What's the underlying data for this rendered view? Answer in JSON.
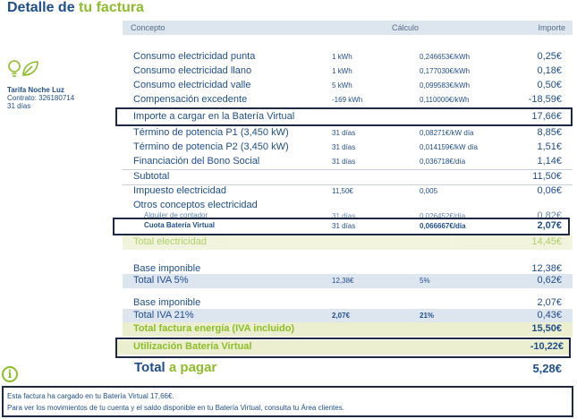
{
  "header": {
    "title_part1": "Detalle de",
    "title_part2": "tu factura",
    "col_concepto": "Concepto",
    "col_calculo": "Cálculo",
    "col_importe": "Importe"
  },
  "contract": {
    "plan": "Tarifa Noche Luz",
    "number": "Contrato: 326180714",
    "days": "31 días"
  },
  "rows": [
    {
      "concepto": "Consumo electricidad punta",
      "cantidad": "1 kWh",
      "precio": "0,246653€/kWh",
      "importe": "0,25€"
    },
    {
      "concepto": "Consumo electricidad llano",
      "cantidad": "1 kWh",
      "precio": "0,177030€/kWh",
      "importe": "0,18€"
    },
    {
      "concepto": "Consumo electricidad valle",
      "cantidad": "5 kWh",
      "precio": "0,099583€/kWh",
      "importe": "0,50€"
    },
    {
      "concepto": "Compensación excedente",
      "cantidad": "-169 kWh",
      "precio": "0,110000€/kWh",
      "importe": "-18,59€"
    },
    {
      "concepto": "Importe a cargar en la Batería Virtual",
      "cantidad": "",
      "precio": "",
      "importe": "17,66€"
    },
    {
      "concepto": "Término de potencia P1 (3,450 kW)",
      "cantidad": "31 días",
      "precio": "0,08271€/kW día",
      "importe": "8,85€"
    },
    {
      "concepto": "Término de potencia P2 (3,450 kW)",
      "cantidad": "31 días",
      "precio": "0,014159€/kW día",
      "importe": "1,51€"
    },
    {
      "concepto": "Financiación del Bono Social",
      "cantidad": "31 días",
      "precio": "0,036718€/día",
      "importe": "1,14€"
    },
    {
      "concepto": "Subtotal",
      "cantidad": "",
      "precio": "",
      "importe": "11,50€"
    },
    {
      "concepto": "Impuesto electricidad",
      "cantidad": "11,50€",
      "precio": "0,005",
      "importe": "0,06€"
    },
    {
      "concepto": "Otros conceptos electricidad",
      "cantidad": "",
      "precio": "",
      "importe": ""
    },
    {
      "concepto": "Alquiler de contador",
      "cantidad": "31 días",
      "precio": "0,026452€/día",
      "importe": "0,82€"
    },
    {
      "concepto": "Cuota Batería Virtual",
      "cantidad": "31 días",
      "precio": "0,066667€/día",
      "importe": "2,07€"
    },
    {
      "concepto": "Total electricidad",
      "cantidad": "",
      "precio": "",
      "importe": "14,45€"
    },
    {
      "concepto": "Base imponible",
      "cantidad": "",
      "precio": "",
      "importe": "12,38€"
    },
    {
      "concepto": "Total IVA 5%",
      "cantidad": "12,38€",
      "precio": "5%",
      "importe": "0,62€"
    },
    {
      "concepto": "Base imponible",
      "cantidad": "",
      "precio": "",
      "importe": "2,07€"
    },
    {
      "concepto": "Total IVA 21%",
      "cantidad": "2,07€",
      "precio": "21%",
      "importe": "0,43€"
    },
    {
      "concepto": "Total factura energía (IVA incluido)",
      "cantidad": "",
      "precio": "",
      "importe": "15,50€"
    },
    {
      "concepto": "Utilización Batería Virtual",
      "cantidad": "",
      "precio": "",
      "importe": "-10,22€"
    }
  ],
  "total": {
    "label_part1": "Total",
    "label_part2": "a pagar",
    "amount": "5,28€"
  },
  "notes": {
    "line1": "Esta factura ha cargado en tu Batería Virtual 17,66€.",
    "line2": "Para ver los movimientos de tu cuenta y el saldo disponible en tu Batería Virtual, consulta tu Área clientes."
  },
  "colors": {
    "brand_blue": "#1f4e8c",
    "brand_green": "#8dbd2a",
    "header_bg": "#dde5ef"
  },
  "icons": [
    "lightbulb-icon",
    "leaf-icon",
    "info-icon"
  ]
}
